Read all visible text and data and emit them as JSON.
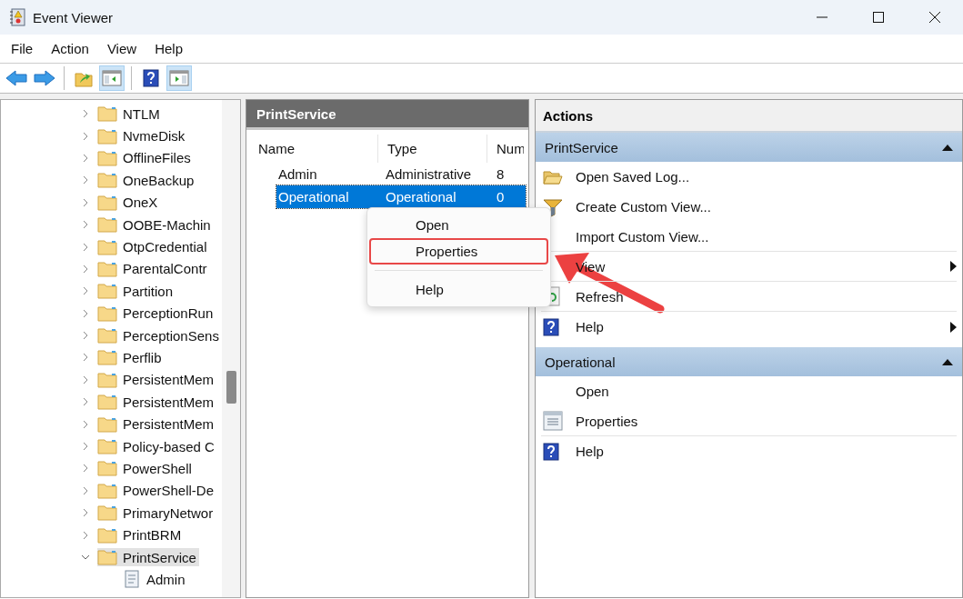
{
  "window": {
    "title": "Event Viewer"
  },
  "menu_bar": [
    "File",
    "Action",
    "View",
    "Help"
  ],
  "toolbar": [
    {
      "pressed": false
    },
    {
      "pressed": false
    },
    {
      "pressed": false
    },
    {
      "pressed": true
    },
    {
      "pressed": false
    },
    {
      "pressed": true
    }
  ],
  "tree": {
    "items": [
      {
        "label": "NTLM",
        "expanded": false,
        "selected": false
      },
      {
        "label": "NvmeDisk",
        "expanded": false,
        "selected": false
      },
      {
        "label": "OfflineFiles",
        "expanded": false,
        "selected": false
      },
      {
        "label": "OneBackup",
        "expanded": false,
        "selected": false
      },
      {
        "label": "OneX",
        "expanded": false,
        "selected": false
      },
      {
        "label": "OOBE-Machin",
        "expanded": false,
        "selected": false
      },
      {
        "label": "OtpCredential",
        "expanded": false,
        "selected": false
      },
      {
        "label": "ParentalContr",
        "expanded": false,
        "selected": false
      },
      {
        "label": "Partition",
        "expanded": false,
        "selected": false
      },
      {
        "label": "PerceptionRun",
        "expanded": false,
        "selected": false
      },
      {
        "label": "PerceptionSens",
        "expanded": false,
        "selected": false
      },
      {
        "label": "Perflib",
        "expanded": false,
        "selected": false
      },
      {
        "label": "PersistentMem",
        "expanded": false,
        "selected": false
      },
      {
        "label": "PersistentMem",
        "expanded": false,
        "selected": false
      },
      {
        "label": "PersistentMem",
        "expanded": false,
        "selected": false
      },
      {
        "label": "Policy-based C",
        "expanded": false,
        "selected": false
      },
      {
        "label": "PowerShell",
        "expanded": false,
        "selected": false
      },
      {
        "label": "PowerShell-De",
        "expanded": false,
        "selected": false
      },
      {
        "label": "PrimaryNetwor",
        "expanded": false,
        "selected": false
      },
      {
        "label": "PrintBRM",
        "expanded": false,
        "selected": false
      },
      {
        "label": "PrintService",
        "expanded": true,
        "selected": true,
        "children": [
          {
            "label": "Admin",
            "selected": false
          }
        ]
      }
    ]
  },
  "log_list": {
    "title": "PrintService",
    "columns": [
      "Name",
      "Type",
      "Num"
    ],
    "rows": [
      {
        "cells": [
          "Admin",
          "Administrative",
          "8"
        ],
        "selected": false
      },
      {
        "cells": [
          "Operational",
          "Operational",
          "0"
        ],
        "selected": true
      }
    ]
  },
  "context_menu": {
    "items": [
      {
        "kind": "item",
        "label": "Open",
        "highlighted": false
      },
      {
        "kind": "item",
        "label": "Properties",
        "highlighted": true
      },
      {
        "kind": "separator"
      },
      {
        "kind": "item",
        "label": "Help",
        "highlighted": false
      }
    ]
  },
  "actions": {
    "title": "Actions",
    "sections": [
      {
        "title": "PrintService",
        "expanded": true,
        "items": [
          {
            "label": "Open Saved Log...",
            "submenu": false,
            "separator_after": false
          },
          {
            "label": "Create Custom View...",
            "submenu": false,
            "separator_after": false
          },
          {
            "label": "Import Custom View...",
            "submenu": false,
            "separator_after": true
          },
          {
            "label": "View",
            "submenu": true,
            "separator_after": true
          },
          {
            "label": "Refresh",
            "submenu": false,
            "separator_after": true
          },
          {
            "label": "Help",
            "submenu": true,
            "separator_after": false
          }
        ]
      },
      {
        "title": "Operational",
        "expanded": true,
        "items": [
          {
            "label": "Open",
            "submenu": false,
            "separator_after": false
          },
          {
            "label": "Properties",
            "submenu": false,
            "separator_after": true
          },
          {
            "label": "Help",
            "submenu": false,
            "separator_after": false
          }
        ]
      }
    ]
  },
  "annotation": {
    "kind": "arrow"
  }
}
